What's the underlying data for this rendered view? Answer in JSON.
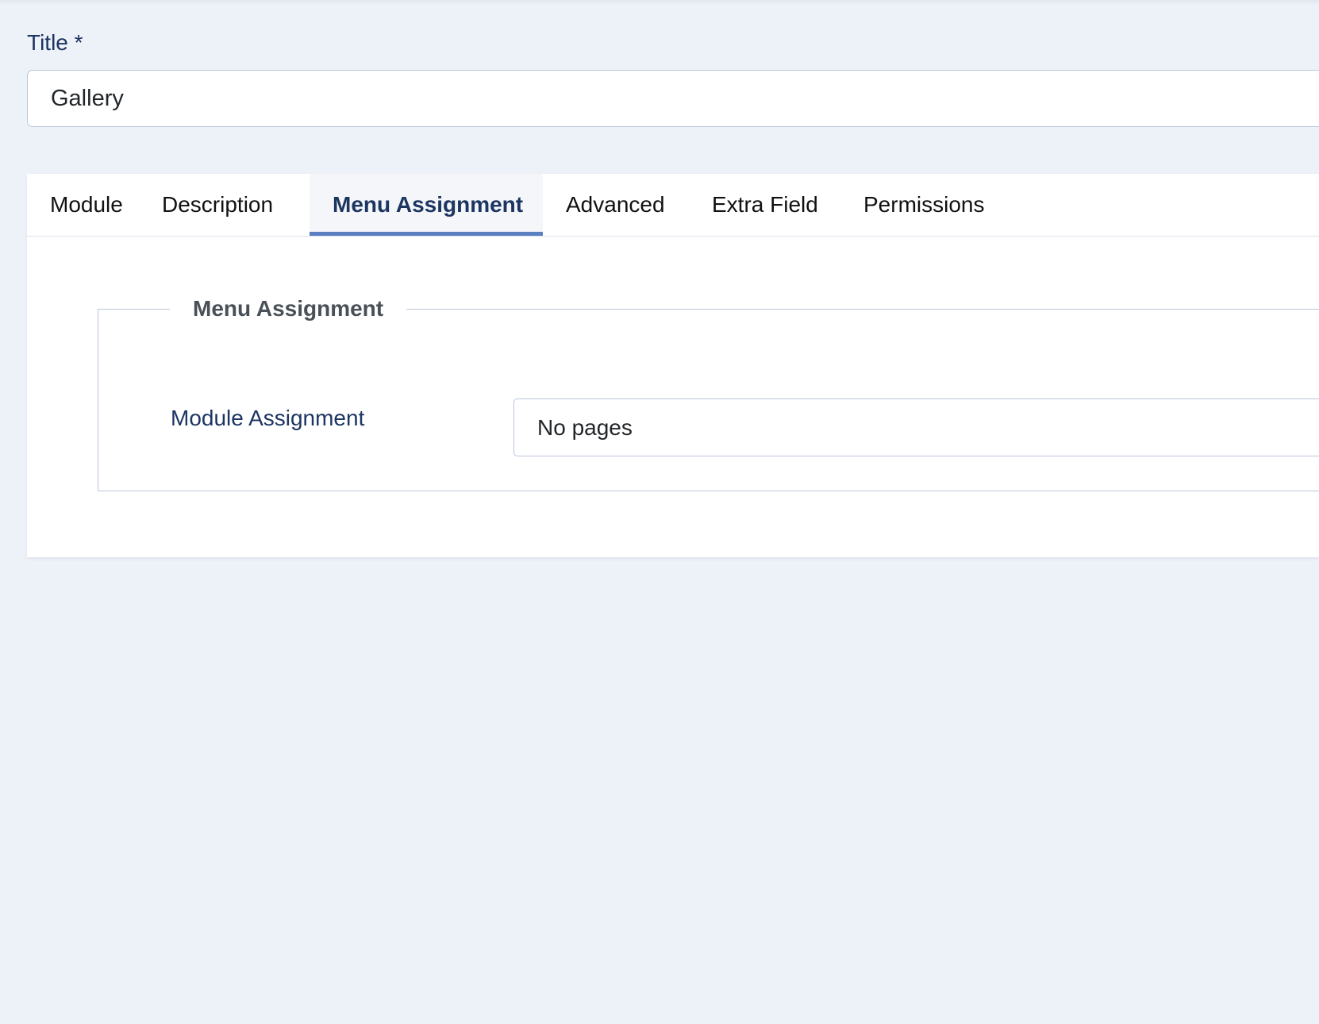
{
  "title_field": {
    "label": "Title *",
    "value": "Gallery"
  },
  "tabs": [
    {
      "label": "Module"
    },
    {
      "label": "Description"
    },
    {
      "label": "Menu Assignment",
      "active": true
    },
    {
      "label": "Advanced"
    },
    {
      "label": "Extra Field"
    },
    {
      "label": "Permissions"
    }
  ],
  "menu_assignment": {
    "legend": "Menu Assignment",
    "module_assignment_label": "Module Assignment",
    "module_assignment_value": "No pages"
  },
  "colors": {
    "accent": "#5b7fc0",
    "label": "#1c3561",
    "background": "#edf1f8"
  }
}
